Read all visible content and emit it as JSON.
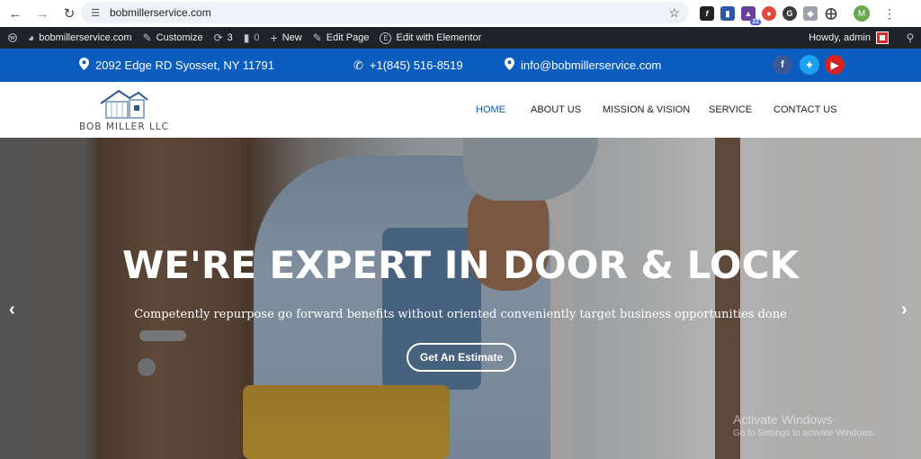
{
  "browser": {
    "url": "bobmillerservice.com",
    "profile_initial": "M",
    "extension_badge": "22"
  },
  "admin_bar": {
    "site_name": "bobmillerservice.com",
    "customize": "Customize",
    "updates_count": "3",
    "comments_count": "0",
    "new": "New",
    "edit_page": "Edit Page",
    "edit_elementor": "Edit with Elementor",
    "howdy": "Howdy, admin"
  },
  "topbar": {
    "address": "2092 Edge RD Syosset, NY 11791",
    "phone": "+1(845) 516-8519",
    "email": "info@bobmillerservice.com",
    "colors": {
      "bar": "#0b5cbf",
      "facebook": "#3b5998",
      "twitter": "#1da1f2",
      "youtube": "#d32323"
    }
  },
  "header": {
    "logo_text": "BOB MILLER LLC",
    "menu": [
      "HOME",
      "ABOUT US",
      "MISSION & VISION",
      "SERVICE",
      "CONTACT US"
    ],
    "active_item": "HOME"
  },
  "hero": {
    "title": "WE'RE EXPERT IN DOOR & LOCK",
    "subtitle": "Competently repurpose go forward benefits without oriented conveniently target business opportunities done",
    "button": "Get An Estimate",
    "prev_arrow": "‹",
    "next_arrow": "›"
  },
  "watermark": {
    "title": "Activate Windows",
    "subtitle": "Go to Settings to activate Windows."
  }
}
